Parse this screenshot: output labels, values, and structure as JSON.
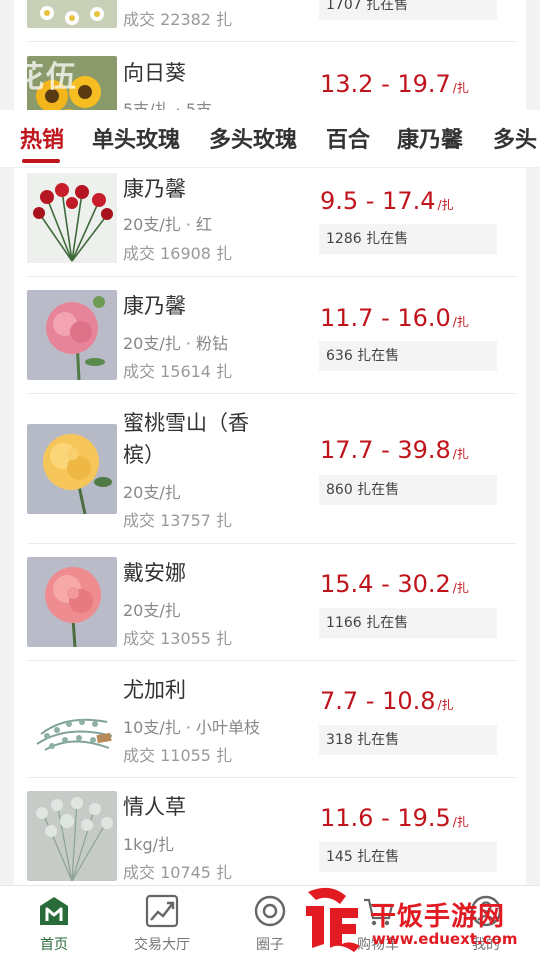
{
  "header": {
    "brand_ghost": "花伍"
  },
  "tabs": [
    {
      "label": "热销",
      "active": true
    },
    {
      "label": "单头玫瑰",
      "active": false
    },
    {
      "label": "多头玫瑰",
      "active": false
    },
    {
      "label": "百合",
      "active": false
    },
    {
      "label": "康乃馨",
      "active": false
    },
    {
      "label": "多头"
    }
  ],
  "partial_items": [
    {
      "deal": "成交 22382 扎",
      "stock": "1707 扎在售"
    },
    {
      "name": "向日葵",
      "spec": "5支/扎 · 5支",
      "price": "13.2 - 19.7",
      "unit": "/扎"
    }
  ],
  "items": [
    {
      "name": "康乃馨",
      "spec": "20支/扎 · 红",
      "deal": "成交 16908 扎",
      "price": "9.5 - 17.4",
      "unit": "/扎",
      "stock": "1286 扎在售",
      "image": "red-carnation"
    },
    {
      "name": "康乃馨",
      "spec": "20支/扎 · 粉钻",
      "deal": "成交 15614 扎",
      "price": "11.7 - 16.0",
      "unit": "/扎",
      "stock": "636 扎在售",
      "image": "pink-carnation"
    },
    {
      "name_line1": "蜜桃雪山（香",
      "name_line2": "槟）",
      "spec": "20支/扎",
      "deal": "成交 13757 扎",
      "price": "17.7 - 39.8",
      "unit": "/扎",
      "stock": "860 扎在售",
      "image": "champagne-rose"
    },
    {
      "name": "戴安娜",
      "spec": "20支/扎",
      "deal": "成交 13055 扎",
      "price": "15.4 - 30.2",
      "unit": "/扎",
      "stock": "1166 扎在售",
      "image": "pink-rose"
    },
    {
      "name": "尤加利",
      "spec": "10支/扎 · 小叶单枝",
      "deal": "成交 11055 扎",
      "price": "7.7 - 10.8",
      "unit": "/扎",
      "stock": "318 扎在售",
      "image": "eucalyptus"
    },
    {
      "name": "情人草",
      "spec": "1kg/扎",
      "deal": "成交 10745 扎",
      "price": "11.6 - 19.5",
      "unit": "/扎",
      "stock": "145 扎在售",
      "image": "limonium"
    }
  ],
  "bottom_nav": [
    {
      "label": "首页",
      "icon": "home-m-icon",
      "active": true
    },
    {
      "label": "交易大厅",
      "icon": "chart-icon",
      "active": false
    },
    {
      "label": "圈子",
      "icon": "circle-icon",
      "active": false
    },
    {
      "label": "购物车",
      "icon": "cart-icon",
      "active": false
    },
    {
      "label": "我的",
      "icon": "profile-icon",
      "active": false
    }
  ],
  "watermark": {
    "title": "干饭手游网",
    "url": "www.eduext.com"
  },
  "colors": {
    "accent": "#c0141c",
    "nav_active": "#2a6b3a"
  }
}
